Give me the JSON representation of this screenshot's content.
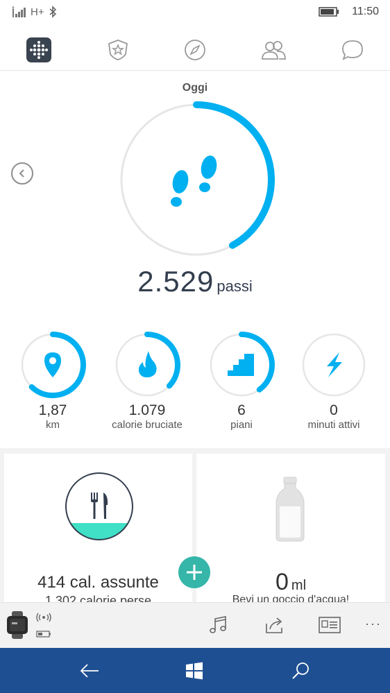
{
  "status_bar": {
    "network": "H+",
    "time": "11:50"
  },
  "tabs": [
    {
      "icon": "dashboard-icon",
      "active": true
    },
    {
      "icon": "badge-star-icon"
    },
    {
      "icon": "compass-icon"
    },
    {
      "icon": "friends-icon"
    },
    {
      "icon": "chat-icon"
    }
  ],
  "today": {
    "title": "Oggi",
    "steps_value": "2.529",
    "steps_unit": "passi",
    "steps_progress": 0.42
  },
  "stats": [
    {
      "icon": "location-pin-icon",
      "value": "1,87",
      "label": "km",
      "progress": 0.62
    },
    {
      "icon": "flame-icon",
      "value": "1.079",
      "label": "calorie bruciate",
      "progress": 0.37
    },
    {
      "icon": "stairs-icon",
      "value": "6",
      "label": "piani",
      "progress": 0.4
    },
    {
      "icon": "lightning-icon",
      "value": "0",
      "label": "minuti attivi",
      "progress": 0
    }
  ],
  "food": {
    "main": "414 cal. assunte",
    "sub": "1.302 calorie perse"
  },
  "water": {
    "value": "0",
    "unit": "ml",
    "sub": "Bevi un goccio d'acqua!"
  },
  "colors": {
    "accent": "#00b0f0",
    "track": "#e6e6e6",
    "teal": "#35b6a9",
    "food_fill": "#3fe0c5",
    "nav": "#1f4f93"
  }
}
